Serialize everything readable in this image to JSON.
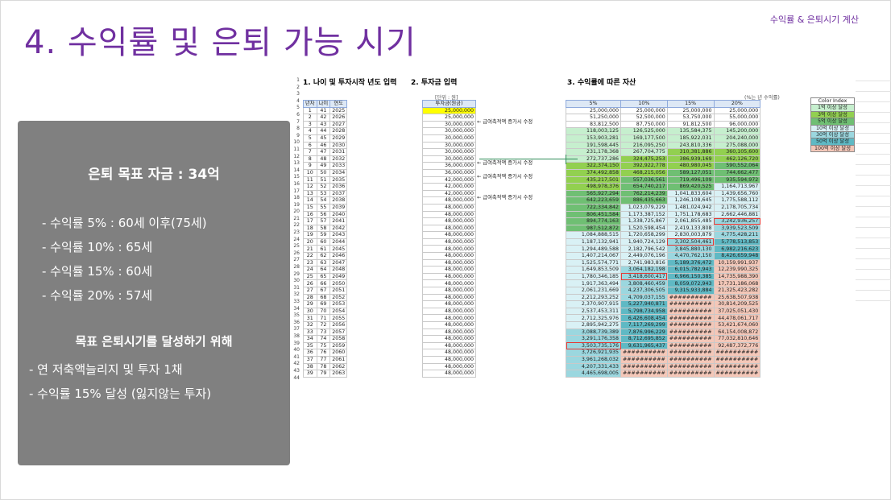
{
  "corner_note": "수익률 & 은퇴시기 계산",
  "title": "4. 수익률 및 은퇴 가능 시기",
  "info": {
    "goal": "은퇴 목표 자금 : 34억",
    "rates": [
      "- 수익률   5% : 60세 이후(75세)",
      "- 수익률 10% : 65세",
      "- 수익률 15% : 60세",
      "- 수익률 20% : 57세"
    ],
    "howto_title": "목표 은퇴시기를 달성하기 위해",
    "howto": [
      "- 연 저축액늘리지 및 투자 1채",
      "- 수익률 15% 달성 (잃지않는 투자)"
    ]
  },
  "sheet": {
    "section1": "1. 나이 및 투자시작 년도 입력",
    "section2": "2. 투자금 입력",
    "section3": "3. 수익률에 따른 자산",
    "unit_invest": "[단위 : 원]",
    "unit_return": "(%는 년 수익률)",
    "left_headers": [
      "년차",
      "나이",
      "연도"
    ],
    "invest_header": "투자금(원금)",
    "return_headers": [
      "5%",
      "10%",
      "15%",
      "20%"
    ],
    "row_numbers": [
      "1",
      "2",
      "3",
      "4",
      "5",
      "6",
      "7",
      "8",
      "9",
      "10",
      "11",
      "12",
      "13",
      "14",
      "15",
      "16",
      "17",
      "18",
      "19",
      "20",
      "21",
      "22",
      "23",
      "24",
      "25",
      "26",
      "27",
      "28",
      "29",
      "30",
      "31",
      "32",
      "33",
      "34",
      "35",
      "36",
      "37",
      "38",
      "39",
      "40",
      "41",
      "42",
      "43",
      "44"
    ],
    "rows": [
      {
        "n": "1",
        "age": "41",
        "yr": "2025",
        "inv": "25,000,000",
        "r": [
          "25,000,000",
          "25,000,000",
          "25,000,000",
          "25,000,000"
        ]
      },
      {
        "n": "2",
        "age": "42",
        "yr": "2026",
        "inv": "25,000,000",
        "r": [
          "51,250,000",
          "52,500,000",
          "53,750,000",
          "55,000,000"
        ]
      },
      {
        "n": "3",
        "age": "43",
        "yr": "2027",
        "inv": "30,000,000",
        "r": [
          "83,812,500",
          "87,750,000",
          "91,812,500",
          "96,000,000"
        ]
      },
      {
        "n": "4",
        "age": "44",
        "yr": "2028",
        "inv": "30,000,000",
        "r": [
          "118,003,125",
          "126,525,000",
          "135,584,375",
          "145,200,000"
        ]
      },
      {
        "n": "5",
        "age": "45",
        "yr": "2029",
        "inv": "30,000,000",
        "r": [
          "153,903,281",
          "169,177,500",
          "185,922,031",
          "204,240,000"
        ]
      },
      {
        "n": "6",
        "age": "46",
        "yr": "2030",
        "inv": "30,000,000",
        "r": [
          "191,598,445",
          "216,095,250",
          "243,810,336",
          "275,088,000"
        ]
      },
      {
        "n": "7",
        "age": "47",
        "yr": "2031",
        "inv": "30,000,000",
        "r": [
          "231,178,368",
          "267,704,775",
          "310,381,886",
          "360,105,600"
        ]
      },
      {
        "n": "8",
        "age": "48",
        "yr": "2032",
        "inv": "30,000,000",
        "r": [
          "272,737,286",
          "324,475,253",
          "386,939,169",
          "462,126,720"
        ]
      },
      {
        "n": "9",
        "age": "49",
        "yr": "2033",
        "inv": "36,000,000",
        "r": [
          "322,374,150",
          "392,922,778",
          "480,980,045",
          "590,552,064"
        ]
      },
      {
        "n": "10",
        "age": "50",
        "yr": "2034",
        "inv": "36,000,000",
        "r": [
          "374,492,858",
          "468,215,056",
          "589,127,051",
          "744,662,477"
        ]
      },
      {
        "n": "11",
        "age": "51",
        "yr": "2035",
        "inv": "42,000,000",
        "r": [
          "435,217,501",
          "557,036,561",
          "719,496,109",
          "935,594,972"
        ]
      },
      {
        "n": "12",
        "age": "52",
        "yr": "2036",
        "inv": "42,000,000",
        "r": [
          "498,978,376",
          "654,740,217",
          "869,420,525",
          "1,164,713,967"
        ]
      },
      {
        "n": "13",
        "age": "53",
        "yr": "2037",
        "inv": "42,000,000",
        "r": [
          "565,927,294",
          "762,214,239",
          "1,041,833,604",
          "1,439,656,760"
        ]
      },
      {
        "n": "14",
        "age": "54",
        "yr": "2038",
        "inv": "48,000,000",
        "r": [
          "642,223,659",
          "886,435,663",
          "1,246,108,645",
          "1,775,588,112"
        ]
      },
      {
        "n": "15",
        "age": "55",
        "yr": "2039",
        "inv": "48,000,000",
        "r": [
          "722,334,842",
          "1,023,079,229",
          "1,481,024,942",
          "2,178,705,734"
        ]
      },
      {
        "n": "16",
        "age": "56",
        "yr": "2040",
        "inv": "48,000,000",
        "r": [
          "806,451,584",
          "1,173,387,152",
          "1,751,178,683",
          "2,662,446,881"
        ]
      },
      {
        "n": "17",
        "age": "57",
        "yr": "2041",
        "inv": "48,000,000",
        "r": [
          "894,774,163",
          "1,338,725,867",
          "2,061,855,485",
          "3,242,936,257"
        ]
      },
      {
        "n": "18",
        "age": "58",
        "yr": "2042",
        "inv": "48,000,000",
        "r": [
          "987,512,872",
          "1,520,598,454",
          "2,419,133,808",
          "3,939,523,509"
        ]
      },
      {
        "n": "19",
        "age": "59",
        "yr": "2043",
        "inv": "48,000,000",
        "r": [
          "1,084,888,515",
          "1,720,658,299",
          "2,830,003,879",
          "4,775,428,211"
        ]
      },
      {
        "n": "20",
        "age": "60",
        "yr": "2044",
        "inv": "48,000,000",
        "r": [
          "1,187,132,941",
          "1,940,724,129",
          "3,302,504,461",
          "5,778,513,853"
        ]
      },
      {
        "n": "21",
        "age": "61",
        "yr": "2045",
        "inv": "48,000,000",
        "r": [
          "1,294,489,588",
          "2,182,796,542",
          "3,845,880,130",
          "6,982,216,623"
        ]
      },
      {
        "n": "22",
        "age": "62",
        "yr": "2046",
        "inv": "48,000,000",
        "r": [
          "1,407,214,067",
          "2,449,076,196",
          "4,470,762,150",
          "8,426,659,948"
        ]
      },
      {
        "n": "23",
        "age": "63",
        "yr": "2047",
        "inv": "48,000,000",
        "r": [
          "1,525,574,771",
          "2,741,983,816",
          "5,189,376,472",
          "10,159,991,937"
        ]
      },
      {
        "n": "24",
        "age": "64",
        "yr": "2048",
        "inv": "48,000,000",
        "r": [
          "1,649,853,509",
          "3,064,182,198",
          "6,015,782,943",
          "12,239,990,325"
        ]
      },
      {
        "n": "25",
        "age": "65",
        "yr": "2049",
        "inv": "48,000,000",
        "r": [
          "1,780,346,185",
          "3,418,600,417",
          "6,966,150,385",
          "14,735,988,390"
        ]
      },
      {
        "n": "26",
        "age": "66",
        "yr": "2050",
        "inv": "48,000,000",
        "r": [
          "1,917,363,494",
          "3,808,460,459",
          "8,059,072,943",
          "17,731,186,068"
        ]
      },
      {
        "n": "27",
        "age": "67",
        "yr": "2051",
        "inv": "48,000,000",
        "r": [
          "2,061,231,669",
          "4,237,306,505",
          "9,315,933,884",
          "21,325,423,282"
        ]
      },
      {
        "n": "28",
        "age": "68",
        "yr": "2052",
        "inv": "48,000,000",
        "r": [
          "2,212,293,252",
          "4,709,037,155",
          "##########",
          "25,638,507,938"
        ]
      },
      {
        "n": "29",
        "age": "69",
        "yr": "2053",
        "inv": "48,000,000",
        "r": [
          "2,370,907,915",
          "5,227,940,871",
          "##########",
          "30,814,209,525"
        ]
      },
      {
        "n": "30",
        "age": "70",
        "yr": "2054",
        "inv": "48,000,000",
        "r": [
          "2,537,453,311",
          "5,798,734,958",
          "##########",
          "37,025,051,430"
        ]
      },
      {
        "n": "31",
        "age": "71",
        "yr": "2055",
        "inv": "48,000,000",
        "r": [
          "2,712,325,976",
          "6,426,608,454",
          "##########",
          "44,478,061,717"
        ]
      },
      {
        "n": "32",
        "age": "72",
        "yr": "2056",
        "inv": "48,000,000",
        "r": [
          "2,895,942,275",
          "7,117,269,299",
          "##########",
          "53,421,674,060"
        ]
      },
      {
        "n": "33",
        "age": "73",
        "yr": "2057",
        "inv": "48,000,000",
        "r": [
          "3,088,739,389",
          "7,876,996,229",
          "##########",
          "64,154,008,872"
        ]
      },
      {
        "n": "34",
        "age": "74",
        "yr": "2058",
        "inv": "48,000,000",
        "r": [
          "3,291,176,358",
          "8,712,695,852",
          "##########",
          "77,032,810,646"
        ]
      },
      {
        "n": "35",
        "age": "75",
        "yr": "2059",
        "inv": "48,000,000",
        "r": [
          "3,503,735,176",
          "9,631,965,437",
          "##########",
          "92,487,372,776"
        ]
      },
      {
        "n": "36",
        "age": "76",
        "yr": "2060",
        "inv": "48,000,000",
        "r": [
          "3,726,921,935",
          "##########",
          "##########",
          "##########"
        ]
      },
      {
        "n": "37",
        "age": "77",
        "yr": "2061",
        "inv": "48,000,000",
        "r": [
          "3,961,268,032",
          "##########",
          "##########",
          "##########"
        ]
      },
      {
        "n": "38",
        "age": "78",
        "yr": "2062",
        "inv": "48,000,000",
        "r": [
          "4,207,331,433",
          "##########",
          "##########",
          "##########"
        ]
      },
      {
        "n": "39",
        "age": "79",
        "yr": "2063",
        "inv": "48,000,000",
        "r": [
          "4,465,698,005",
          "##########",
          "##########",
          "##########"
        ]
      }
    ],
    "notes": [
      {
        "row": 3,
        "text": "← 급여축적액 증가시 수정"
      },
      {
        "row": 9,
        "text": "← 급여축적액 증가시 수정"
      },
      {
        "row": 11,
        "text": "← 급여축적액 증가시 수정"
      },
      {
        "row": 14,
        "text": "← 급여축적액 증가시 수정"
      }
    ],
    "highlights": [
      {
        "row": 17,
        "col": 3
      },
      {
        "row": 20,
        "col": 2
      },
      {
        "row": 25,
        "col": 1
      },
      {
        "row": 35,
        "col": 0
      }
    ],
    "legend_header": "Color Index",
    "legend": [
      {
        "label": "1억 이상 달성",
        "color": "#c6efce"
      },
      {
        "label": "3억 이상 달성",
        "color": "#92d050"
      },
      {
        "label": "5억 이상 달성",
        "color": "#6fbf73"
      },
      {
        "label": "10억 이상 달성",
        "color": "#d9f1f5"
      },
      {
        "label": "30억 이상 달성",
        "color": "#9bd7df"
      },
      {
        "label": "50억 이상 달성",
        "color": "#5fb9c4"
      },
      {
        "label": "100억 이상 달성",
        "color": "#f4c7b8"
      }
    ],
    "colors": {
      "first_invest": "#ffff00",
      "highlight_border": "#e53935",
      "header": "#dde8f5",
      "title": "#7030a0"
    }
  }
}
